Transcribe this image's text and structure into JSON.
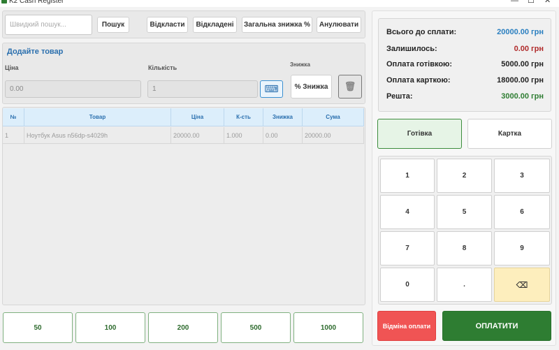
{
  "window": {
    "title": "K2 Cash Register",
    "min": "—",
    "max": "☐",
    "close": "✕"
  },
  "toolbar": {
    "search_placeholder": "Швидкий пошук...",
    "search_label": "Пошук",
    "postpone_label": "Відкласти",
    "postponed_label": "Відкладені",
    "total_discount_label": "Загальна знижка %",
    "cancel_label": "Анулювати"
  },
  "add_item": {
    "title": "Додайте товар",
    "price_label": "Ціна",
    "price_value": "0.00",
    "qty_label": "Кількість",
    "qty_value": "1",
    "discount_label": "Знижка",
    "discount_button": "% Знижка",
    "keyboard_icon": "⌨",
    "trash_icon": "🗑"
  },
  "table": {
    "headers": [
      "№",
      "Товар",
      "Ціна",
      "К-сть",
      "Знижка",
      "Сума"
    ],
    "rows": [
      [
        "1",
        "Ноутбук Asus n56dp-s4029h",
        "20000.00",
        "1.000",
        "0.00",
        "20000.00"
      ]
    ]
  },
  "summary": {
    "total_label": "Всього до сплати:",
    "total_value": "20000.00 грн",
    "remaining_label": "Залишилось:",
    "remaining_value": "0.00 грн",
    "cash_label": "Оплата готівкою:",
    "cash_value": "5000.00 грн",
    "card_label": "Оплата карткою:",
    "card_value": "18000.00 грн",
    "change_label": "Решта:",
    "change_value": "3000.00 грн",
    "colors": {
      "total": "#2a7fc0",
      "remaining": "#b02a2a",
      "change": "#2e7d32"
    }
  },
  "payment": {
    "cash": "Готівка",
    "card": "Картка"
  },
  "keypad": [
    "1",
    "2",
    "3",
    "4",
    "5",
    "6",
    "7",
    "8",
    "9",
    "0",
    ".",
    "⌫"
  ],
  "quick_amounts": [
    "50",
    "100",
    "200",
    "500",
    "1000"
  ],
  "actions": {
    "cancel_payment": "Відміна оплати",
    "pay": "ОПЛАТИТИ"
  }
}
